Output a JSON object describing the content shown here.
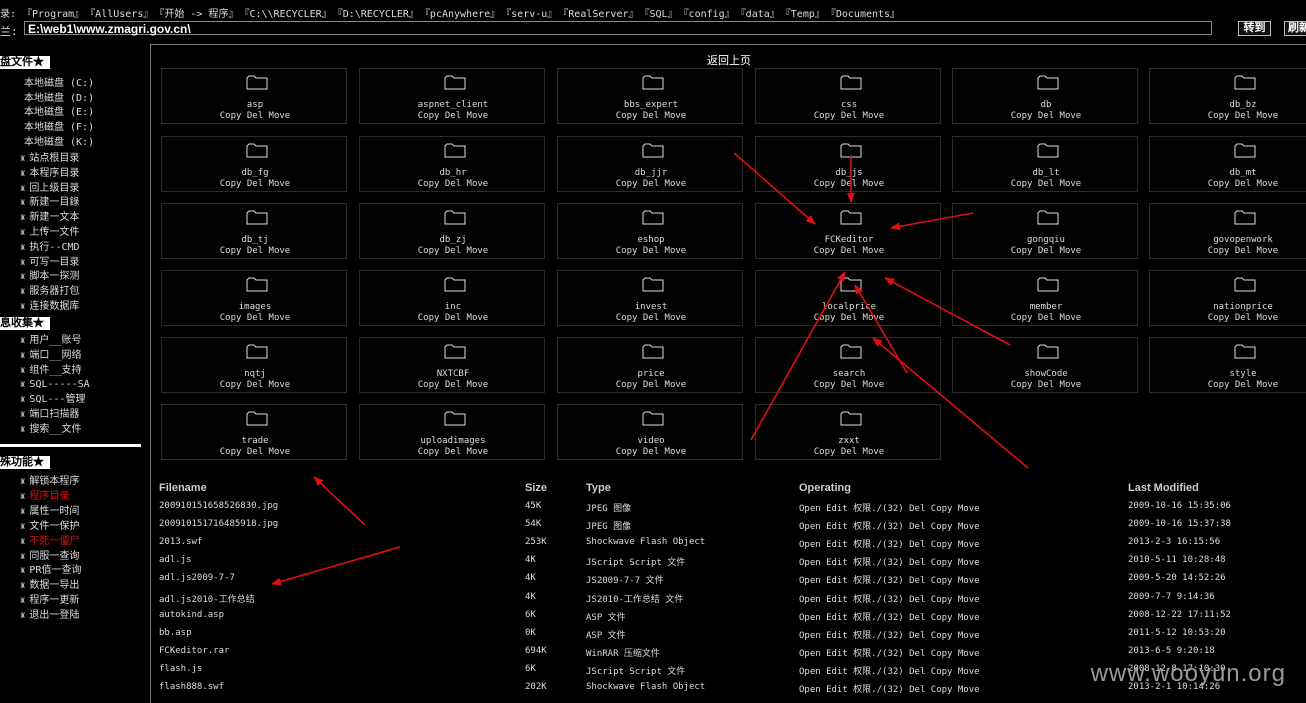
{
  "quickbar": {
    "label": "录:",
    "links": [
      "『Program』",
      "『AllUsers』",
      "『开始 -> 程序』",
      "『C:\\\\RECYCLER』",
      "『D:\\RECYCLER』",
      "『pcAnywhere』",
      "『serv-u』",
      "『RealServer』",
      "『SQL』",
      "『config』",
      "『data』",
      "『Temp』",
      "『Documents』"
    ]
  },
  "pathbar": {
    "label": "兰:",
    "value": "E:\\web1\\www.zmagri.gov.cn\\",
    "go_label": "转到",
    "refresh_label": "刷新"
  },
  "sidebar": {
    "sec1_title": "盘文件★",
    "drives": [
      "本地磁盘 (C:)",
      "本地磁盘 (D:)",
      "本地磁盘 (E:)",
      "本地磁盘 (F:)",
      "本地磁盘 (K:)"
    ],
    "nav": [
      "站点根目录",
      "本程序目录",
      "回上级目录",
      "新建一目錄",
      "新建一文本",
      "上传一文件",
      "执行--CMD",
      "可写一目录",
      "脚本一探测",
      "服务器打包",
      "连接数据库"
    ],
    "sec2_title": "息收集★",
    "info": [
      "用户__账号",
      "端口__网络",
      "组件__支持",
      "SQL-----SA",
      "SQL---管理",
      "端口扫描器",
      "搜索__文件"
    ],
    "sec3_title": "殊功能★",
    "special": [
      {
        "label": "解锁本程序",
        "red": false
      },
      {
        "label": "程序目录",
        "red": true
      },
      {
        "label": "属性一时间",
        "red": false
      },
      {
        "label": "文件一保护",
        "red": false
      },
      {
        "label": "不死一僵尸",
        "red": true
      },
      {
        "label": "同服一查询",
        "red": false
      },
      {
        "label": "PR值一查询",
        "red": false
      },
      {
        "label": "数据一导出",
        "red": false
      },
      {
        "label": "程序一更新",
        "red": false
      },
      {
        "label": "退出一登陆",
        "red": false
      }
    ]
  },
  "main": {
    "back_label": "返回上页",
    "folder_actions": "Copy Del Move",
    "folders": [
      "asp",
      "aspnet_client",
      "bbs_expert",
      "css",
      "db",
      "db_bz",
      "db_fg",
      "db_hr",
      "db_jjr",
      "db_js",
      "db_lt",
      "db_mt",
      "db_tj",
      "db_zj",
      "eshop",
      "FCKeditor",
      "gongqiu",
      "govopenwork",
      "images",
      "inc",
      "invest",
      "localprice",
      "member",
      "nationprice",
      "nqtj",
      "NXTCBF",
      "price",
      "search",
      "showCode",
      "style",
      "trade",
      "uploadimages",
      "video",
      "zxxt"
    ],
    "table_headers": {
      "filename": "Filename",
      "size": "Size",
      "type": "Type",
      "operating": "Operating",
      "modified": "Last Modified"
    },
    "operating_text": "Open Edit 权限./(32) Del Copy Move",
    "files": [
      {
        "name": "200910151658526830.jpg",
        "size": "45K",
        "type": "JPEG 图像",
        "modified": "2009-10-16 15:35:06"
      },
      {
        "name": "200910151716485918.jpg",
        "size": "54K",
        "type": "JPEG 图像",
        "modified": "2009-10-16 15:37:38"
      },
      {
        "name": "2013.swf",
        "size": "253K",
        "type": "Shockwave Flash Object",
        "modified": "2013-2-3 16:15:56"
      },
      {
        "name": "adl.js",
        "size": "4K",
        "type": "JScript Script 文件",
        "modified": "2010-5-11 10:28:48"
      },
      {
        "name": "adl.js2009-7-7",
        "size": "4K",
        "type": "JS2009-7-7 文件",
        "modified": "2009-5-20 14:52:26"
      },
      {
        "name": "adl.js2010-工作总结",
        "size": "4K",
        "type": "JS2010-工作总结 文件",
        "modified": "2009-7-7 9:14:36"
      },
      {
        "name": "autokind.asp",
        "size": "6K",
        "type": "ASP 文件",
        "modified": "2008-12-22 17:11:52"
      },
      {
        "name": "bb.asp",
        "size": "0K",
        "type": "ASP 文件",
        "modified": "2011-5-12 10:53:20"
      },
      {
        "name": "FCKeditor.rar",
        "size": "694K",
        "type": "WinRAR 压缩文件",
        "modified": "2013-6-5 9:20:18"
      },
      {
        "name": "flash.js",
        "size": "6K",
        "type": "JScript Script 文件",
        "modified": "2008-12-8 17:10:30"
      },
      {
        "name": "flash888.swf",
        "size": "202K",
        "type": "Shockwave Flash Object",
        "modified": "2013-2-1 10:14:26"
      }
    ]
  },
  "watermark": "www.wooyun.org",
  "colors": {
    "background": "#000000",
    "annotation_arrow": "#e01010",
    "highlight_text": "#e01010"
  }
}
